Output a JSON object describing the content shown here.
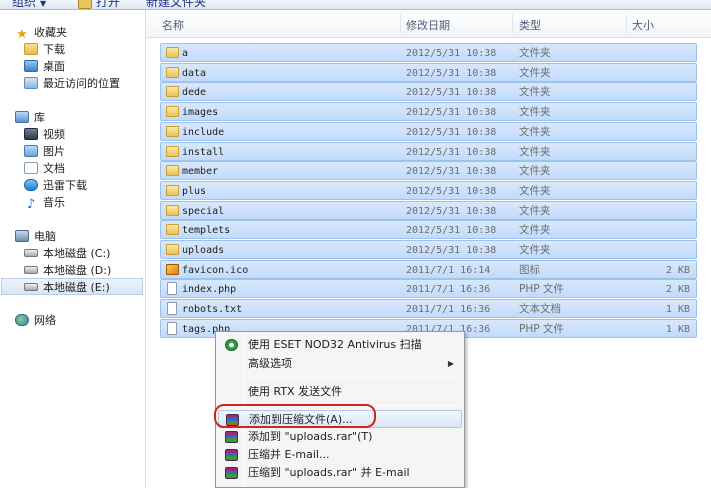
{
  "toolbar": {
    "organize": "组织",
    "open": "打开",
    "new_folder": "新建文件夹"
  },
  "nav": {
    "favorites": {
      "header": "收藏夹",
      "items": [
        "下载",
        "桌面",
        "最近访问的位置"
      ]
    },
    "libraries": {
      "header": "库",
      "items": [
        "视频",
        "图片",
        "文档",
        "迅雷下载",
        "音乐"
      ]
    },
    "computer": {
      "header": "电脑",
      "drives": [
        "本地磁盘 (C:)",
        "本地磁盘 (D:)",
        "本地磁盘 (E:)"
      ],
      "selected_drive": "本地磁盘 (E:)"
    },
    "network": "网络"
  },
  "columns": {
    "name": "名称",
    "modified": "修改日期",
    "type": "类型",
    "size": "大小"
  },
  "files": [
    {
      "name": "a",
      "date": "2012/5/31 10:38",
      "type": "文件夹",
      "size": "",
      "icon": "folder-icon"
    },
    {
      "name": "data",
      "date": "2012/5/31 10:38",
      "type": "文件夹",
      "size": "",
      "icon": "folder-icon"
    },
    {
      "name": "dede",
      "date": "2012/5/31 10:38",
      "type": "文件夹",
      "size": "",
      "icon": "folder-icon"
    },
    {
      "name": "images",
      "date": "2012/5/31 10:38",
      "type": "文件夹",
      "size": "",
      "icon": "folder-icon"
    },
    {
      "name": "include",
      "date": "2012/5/31 10:38",
      "type": "文件夹",
      "size": "",
      "icon": "folder-icon"
    },
    {
      "name": "install",
      "date": "2012/5/31 10:38",
      "type": "文件夹",
      "size": "",
      "icon": "folder-icon"
    },
    {
      "name": "member",
      "date": "2012/5/31 10:38",
      "type": "文件夹",
      "size": "",
      "icon": "folder-icon"
    },
    {
      "name": "plus",
      "date": "2012/5/31 10:38",
      "type": "文件夹",
      "size": "",
      "icon": "folder-icon"
    },
    {
      "name": "special",
      "date": "2012/5/31 10:38",
      "type": "文件夹",
      "size": "",
      "icon": "folder-icon"
    },
    {
      "name": "templets",
      "date": "2012/5/31 10:38",
      "type": "文件夹",
      "size": "",
      "icon": "folder-icon"
    },
    {
      "name": "uploads",
      "date": "2012/5/31 10:38",
      "type": "文件夹",
      "size": "",
      "icon": "folder-icon"
    },
    {
      "name": "favicon.ico",
      "date": "2011/7/1 16:14",
      "type": "图标",
      "size": "2 KB",
      "icon": "favicon-icon"
    },
    {
      "name": "index.php",
      "date": "2011/7/1 16:36",
      "type": "PHP 文件",
      "size": "2 KB",
      "icon": "file-icon"
    },
    {
      "name": "robots.txt",
      "date": "2011/7/1 16:36",
      "type": "文本文档",
      "size": "1 KB",
      "icon": "file-icon"
    },
    {
      "name": "tags.php",
      "date": "2011/7/1 16:36",
      "type": "PHP 文件",
      "size": "1 KB",
      "icon": "file-icon"
    }
  ],
  "context_menu": {
    "items": [
      {
        "label": "使用 ESET NOD32 Antivirus 扫描",
        "icon": "eset-icon"
      },
      {
        "label": "高级选项",
        "submenu": true
      },
      {
        "label": "使用 RTX 发送文件"
      },
      {
        "label": "添加到压缩文件(A)...",
        "icon": "winrar-icon",
        "highlighted": true
      },
      {
        "label": "添加到 \"uploads.rar\"(T)",
        "icon": "winrar-icon"
      },
      {
        "label": "压缩并 E-mail...",
        "icon": "winrar-icon"
      },
      {
        "label": "压缩到 \"uploads.rar\" 并 E-mail",
        "icon": "winrar-icon"
      }
    ]
  },
  "colors": {
    "selection_fill": "#cce1fb",
    "selection_border": "#9dc2ec",
    "annotation_ring": "#d4241c"
  }
}
